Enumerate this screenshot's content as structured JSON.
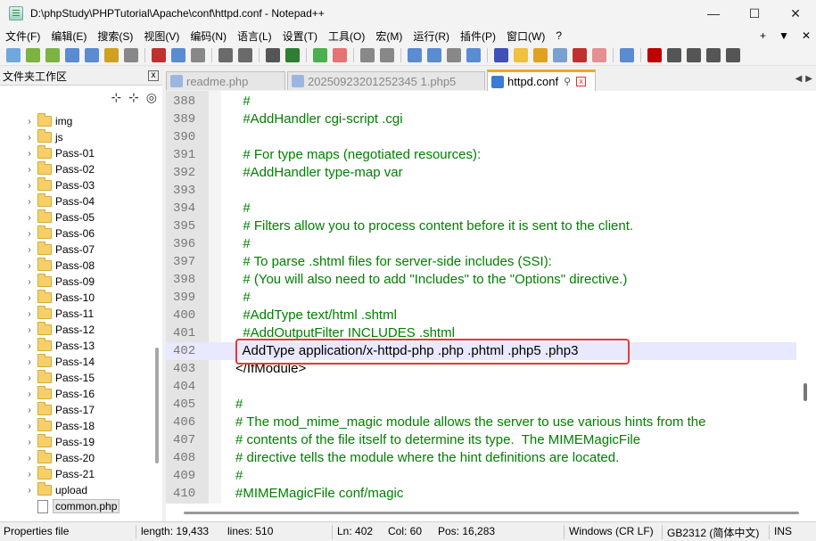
{
  "window": {
    "title": "D:\\phpStudy\\PHPTutorial\\Apache\\conf\\httpd.conf - Notepad++",
    "buttons": {
      "minimize": "—",
      "maximize": "☐",
      "close": "✕"
    }
  },
  "menu": {
    "items": [
      "文件(F)",
      "编辑(E)",
      "搜索(S)",
      "视图(V)",
      "编码(N)",
      "语言(L)",
      "设置(T)",
      "工具(O)",
      "宏(M)",
      "运行(R)",
      "插件(P)",
      "窗口(W)",
      "?"
    ],
    "right": [
      "+",
      "▼",
      "✕"
    ]
  },
  "panel": {
    "title": "文件夹工作区",
    "close": "x",
    "tools": [
      "⊹",
      "⊹",
      "◎"
    ]
  },
  "tree": [
    {
      "label": "img",
      "type": "folder"
    },
    {
      "label": "js",
      "type": "folder"
    },
    {
      "label": "Pass-01",
      "type": "folder"
    },
    {
      "label": "Pass-02",
      "type": "folder"
    },
    {
      "label": "Pass-03",
      "type": "folder"
    },
    {
      "label": "Pass-04",
      "type": "folder"
    },
    {
      "label": "Pass-05",
      "type": "folder"
    },
    {
      "label": "Pass-06",
      "type": "folder"
    },
    {
      "label": "Pass-07",
      "type": "folder"
    },
    {
      "label": "Pass-08",
      "type": "folder"
    },
    {
      "label": "Pass-09",
      "type": "folder"
    },
    {
      "label": "Pass-10",
      "type": "folder"
    },
    {
      "label": "Pass-11",
      "type": "folder"
    },
    {
      "label": "Pass-12",
      "type": "folder"
    },
    {
      "label": "Pass-13",
      "type": "folder"
    },
    {
      "label": "Pass-14",
      "type": "folder"
    },
    {
      "label": "Pass-15",
      "type": "folder"
    },
    {
      "label": "Pass-16",
      "type": "folder"
    },
    {
      "label": "Pass-17",
      "type": "folder"
    },
    {
      "label": "Pass-18",
      "type": "folder"
    },
    {
      "label": "Pass-19",
      "type": "folder"
    },
    {
      "label": "Pass-20",
      "type": "folder"
    },
    {
      "label": "Pass-21",
      "type": "folder"
    },
    {
      "label": "upload",
      "type": "folder"
    },
    {
      "label": "common.php",
      "type": "file",
      "selected": true
    }
  ],
  "tabs": [
    {
      "label": "readme.php",
      "active": false
    },
    {
      "label": "20250923201252345 1.php5",
      "active": false
    },
    {
      "label": "httpd.conf",
      "active": true,
      "pin": "⚲",
      "close": "x"
    }
  ],
  "tab_nav": [
    "◀",
    "▶"
  ],
  "editor": {
    "lines": [
      {
        "n": "388",
        "text": "  #",
        "style": "comment"
      },
      {
        "n": "389",
        "text": "  #AddHandler cgi-script .cgi",
        "style": "comment"
      },
      {
        "n": "390",
        "text": "",
        "style": "comment"
      },
      {
        "n": "391",
        "text": "  # For type maps (negotiated resources):",
        "style": "comment"
      },
      {
        "n": "392",
        "text": "  #AddHandler type-map var",
        "style": "comment"
      },
      {
        "n": "393",
        "text": "",
        "style": "comment"
      },
      {
        "n": "394",
        "text": "  #",
        "style": "comment"
      },
      {
        "n": "395",
        "text": "  # Filters allow you to process content before it is sent to the client.",
        "style": "comment"
      },
      {
        "n": "396",
        "text": "  #",
        "style": "comment"
      },
      {
        "n": "397",
        "text": "  # To parse .shtml files for server-side includes (SSI):",
        "style": "comment"
      },
      {
        "n": "398",
        "text": "  # (You will also need to add \"Includes\" to the \"Options\" directive.)",
        "style": "comment"
      },
      {
        "n": "399",
        "text": "  #",
        "style": "comment"
      },
      {
        "n": "400",
        "text": "  #AddType text/html .shtml",
        "style": "comment"
      },
      {
        "n": "401",
        "text": "  #AddOutputFilter INCLUDES .shtml",
        "style": "comment"
      },
      {
        "n": "402",
        "text": "  AddType application/x-httpd-php .php .phtml .php5 .php3",
        "style": "plain",
        "caret": true
      },
      {
        "n": "403",
        "text": "</IfModule>",
        "style": "plain"
      },
      {
        "n": "404",
        "text": "",
        "style": "plain"
      },
      {
        "n": "405",
        "text": "#",
        "style": "comment"
      },
      {
        "n": "406",
        "text": "# The mod_mime_magic module allows the server to use various hints from the",
        "style": "comment"
      },
      {
        "n": "407",
        "text": "# contents of the file itself to determine its type.  The MIMEMagicFile",
        "style": "comment"
      },
      {
        "n": "408",
        "text": "# directive tells the module where the hint definitions are located.",
        "style": "comment"
      },
      {
        "n": "409",
        "text": "#",
        "style": "comment"
      },
      {
        "n": "410",
        "text": "#MIMEMagicFile conf/magic",
        "style": "comment"
      }
    ]
  },
  "status": {
    "type": "Properties file",
    "length": "length: 19,433",
    "lines": "lines: 510",
    "ln": "Ln: 402",
    "col": "Col: 60",
    "pos": "Pos: 16,283",
    "eol": "Windows (CR LF)",
    "encoding": "GB2312 (简体中文)",
    "mode": "INS"
  },
  "colors": {
    "comment": "#008000",
    "highlight": "#e53935",
    "active_tab": "#f5a623",
    "caret_line": "#e8e8ff"
  }
}
